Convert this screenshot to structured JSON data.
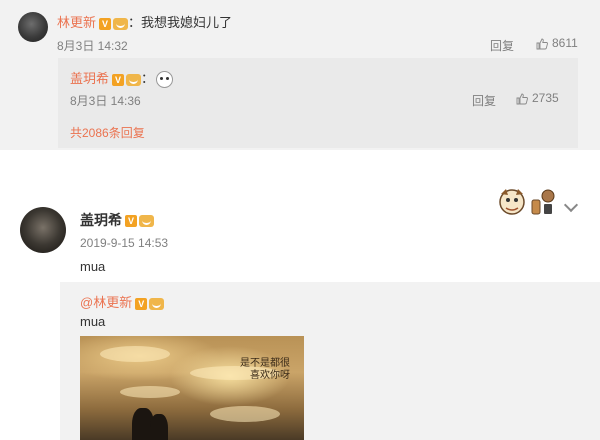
{
  "comment": {
    "author": "林更新",
    "text": "：我想我媳妇儿了",
    "time": "8月3日 14:32",
    "reply_label": "回复",
    "likes": "8611",
    "reply": {
      "author": "盖玥希",
      "text": "：",
      "time": "8月3日 14:36",
      "reply_label": "回复",
      "likes": "2735"
    },
    "more_replies": "共2086条回复"
  },
  "post": {
    "author": "盖玥希",
    "time": "2019-9-15 14:53",
    "text": "mua",
    "repost": {
      "author": "@林更新",
      "text": "mua",
      "photo_caption_line1": "是不是都很",
      "photo_caption_line2": "喜欢你呀"
    }
  },
  "icons": {
    "verified": "verified-v-badge",
    "member": "member-crown-icon",
    "like": "thumbs-up-icon"
  },
  "colors": {
    "name_orange": "#eb7350",
    "badge_gold": "#f3a223",
    "meta_gray": "#808080"
  }
}
